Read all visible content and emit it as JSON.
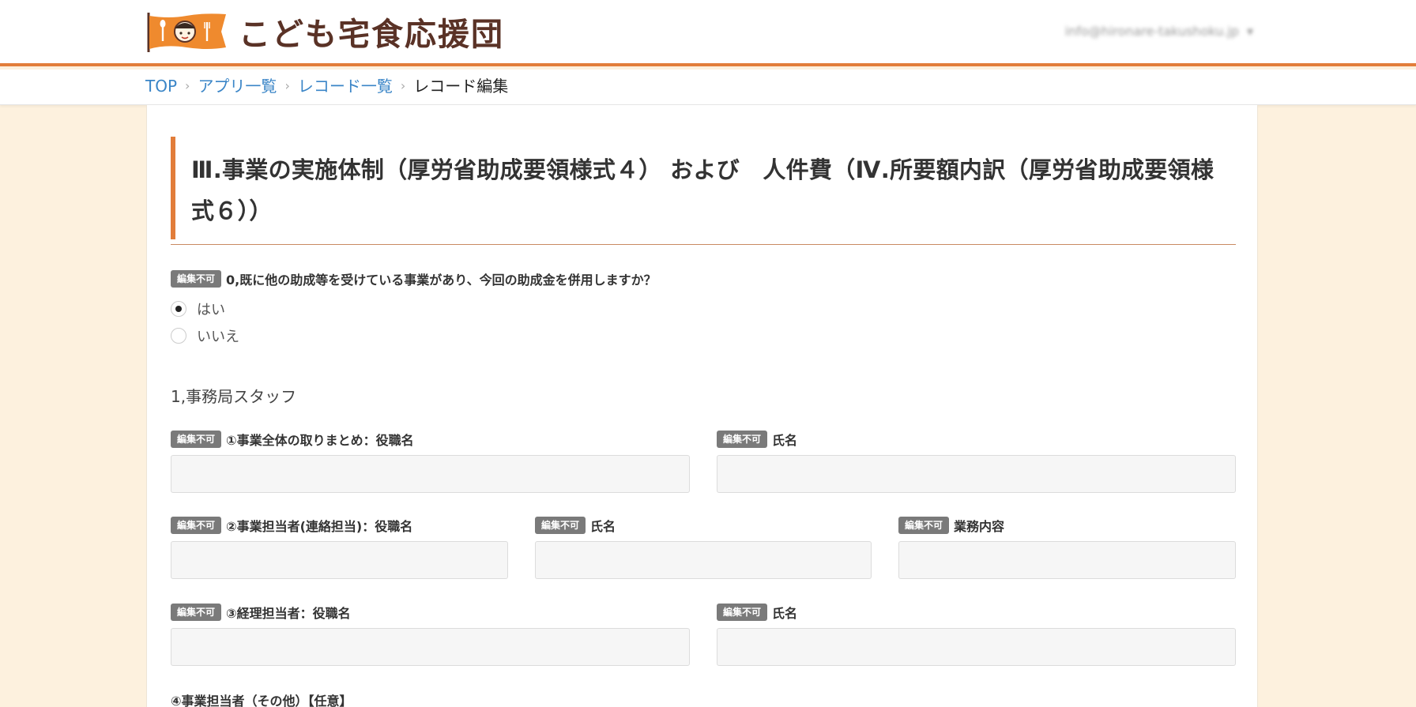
{
  "header": {
    "logo_text": "こども宅食応援団",
    "account_email": "info@hironare-takushoku.jp"
  },
  "breadcrumb": {
    "top": "TOP",
    "apps": "アプリ一覧",
    "records": "レコード一覧",
    "current": "レコード編集"
  },
  "section": {
    "title": "Ⅲ.事業の実施体制（厚労省助成要領様式４） および　人件費（Ⅳ.所要額内訳（厚労省助成要領様式６））"
  },
  "badge_label": "編集不可",
  "q0": {
    "label": "0,既に他の助成等を受けている事業があり、今回の助成金を併用しますか？",
    "options": [
      "はい",
      "いいえ"
    ],
    "selected": "はい"
  },
  "staff": {
    "heading": "1,事務局スタッフ",
    "f1_title": "①事業全体の取りまとめ：役職名",
    "f1_name": "氏名",
    "f2_title": "②事業担当者(連絡担当)：役職名",
    "f2_name": "氏名",
    "f2_work": "業務内容",
    "f3_title": "③経理担当者：役職名",
    "f3_name": "氏名",
    "f4_heading": "④事業担当者（その他）【任意】"
  },
  "colors": {
    "accent": "#e27d3a",
    "background": "#fdf1de",
    "link": "#3a85c7",
    "badge": "#7a7a7a"
  }
}
